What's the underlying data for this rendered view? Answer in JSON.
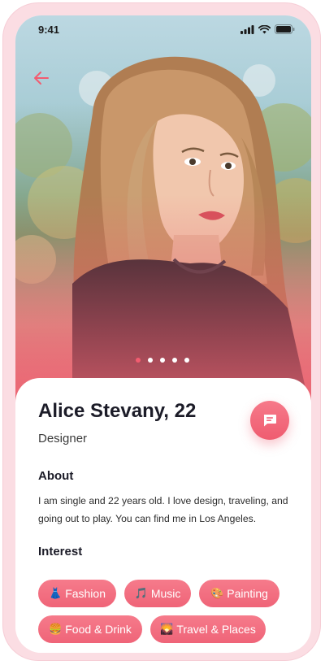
{
  "status_bar": {
    "time": "9:41"
  },
  "header": {
    "back_icon": "arrow-left-icon"
  },
  "carousel": {
    "total_pages": 5,
    "active_page": 1
  },
  "profile": {
    "name": "Alice Stevany, 22",
    "role": "Designer",
    "chat_icon": "message-icon"
  },
  "about": {
    "title": "About",
    "text": "I am single and 22 years old. I love design, traveling, and going out to play. You can find me in Los Angeles."
  },
  "interest": {
    "title": "Interest",
    "items": [
      {
        "emoji": "👗",
        "label": "Fashion"
      },
      {
        "emoji": "🎵",
        "label": "Music"
      },
      {
        "emoji": "🎨",
        "label": "Painting"
      },
      {
        "emoji": "🍔",
        "label": "Food & Drink"
      },
      {
        "emoji": "🌄",
        "label": "Travel & Places"
      }
    ]
  },
  "colors": {
    "accent": "#ef5c70",
    "frame": "#fbdde3"
  }
}
